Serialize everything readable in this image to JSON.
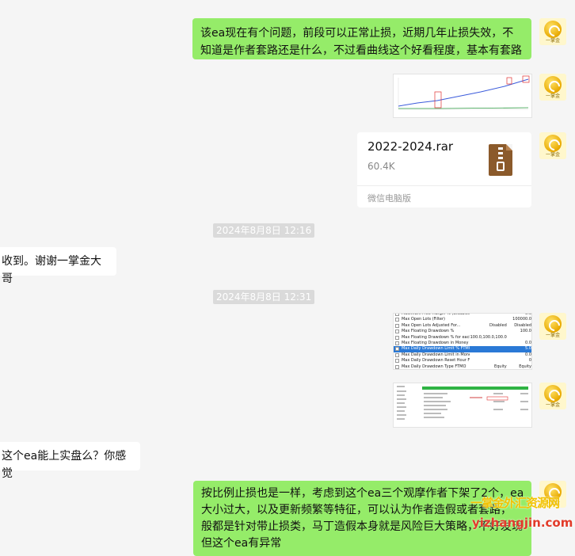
{
  "messages": {
    "msg1": "该ea现在有个问题，前段可以正常止损，近期几年止损失效，不知道是作者套路还是什么，不过看曲线这个好看程度，基本有套路",
    "msg2": "收到。谢谢一掌金大哥",
    "msg3": "这个ea能上实盘么？你感觉",
    "msg4_line1": "按比例止损也是一样，考虑到这个ea三个观摩作者下架了2个，ea",
    "msg4_line2": "大小过大，以及更新频繁等特征，可以认为作者造假或者套路，",
    "msg4_line3": "般都是针对带止损类，马丁造假本身就是风险巨大策略，不好发现",
    "msg4_line4": "但这个ea有异常"
  },
  "timestamps": {
    "t1": "2024年8月8日 12:16",
    "t2": "2024年8月8日 12:31"
  },
  "file": {
    "name": "2022-2024.rar",
    "size": "60.4K",
    "source": "微信电脑版",
    "icon": "zip-archive-icon"
  },
  "avatar": {
    "label": "一掌金"
  },
  "settings_table": {
    "rows": [
      {
        "k": "Maximum Free Margin % (Disabled)",
        "v1": "",
        "v2": "0.0",
        "hl": false
      },
      {
        "k": "Max Open Lots (Filter)",
        "v1": "",
        "v2": "100000.0",
        "hl": false
      },
      {
        "k": "Max Open Lots Adjusted For...",
        "v1": "Disabled",
        "v2": "Disabled",
        "hl": false
      },
      {
        "k": "Max Floating Drawdown %",
        "v1": "",
        "v2": "100.0",
        "hl": false
      },
      {
        "k": "Max Floating Drawdown % for each Symb...",
        "v1": "100.0,100.0,100.0",
        "v2": "",
        "hl": false
      },
      {
        "k": "Max Floating Drawdown in Money ($=disa...",
        "v1": "",
        "v2": "0.0",
        "hl": false
      },
      {
        "k": "Max Daily Drawdown Limit % FTMO Rules",
        "v1": "",
        "v2": "5.0",
        "hl": true
      },
      {
        "k": "Max Daily Drawdown Limit in Money FTM...",
        "v1": "",
        "v2": "0.0",
        "hl": false
      },
      {
        "k": "Max Daily Drawdown Reset Hour FTMO R...",
        "v1": "",
        "v2": "0",
        "hl": false
      },
      {
        "k": "Max Daily Drawdown Type FTMO",
        "v1": "Equity",
        "v2": "Equity",
        "hl": false
      }
    ]
  },
  "watermark": {
    "line1": "一掌金外汇资源网",
    "line2": "yizhangjin.com"
  },
  "colors": {
    "bubble_green": "#95ec69",
    "bubble_white": "#ffffff",
    "background": "#f5f5f5",
    "watermark_yellow": "#f2c200",
    "watermark_red": "#e23b2a"
  }
}
